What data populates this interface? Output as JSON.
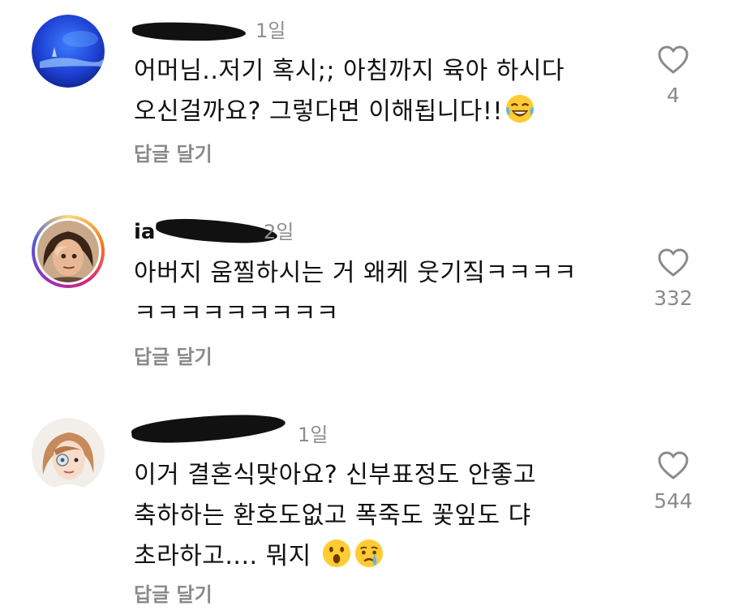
{
  "comments": [
    {
      "username_visible": "",
      "time": "1일",
      "text_line1": "어머님..저기 혹시;; 아침까지 육아 하시다",
      "text_line2": "오신걸까요? 그렇다면 이해됩니다!!",
      "emoji": [
        "laugh-tears-emoji"
      ],
      "reply_label": "답글 달기",
      "likes": "4"
    },
    {
      "username_visible": "ia",
      "time": "2일",
      "text_line1": "아버지 움찔하시는 거 왜케 웃기짘ㅋㅋㅋㅋ",
      "text_line2": "ㅋㅋㅋㅋㅋㅋㅋㅋㅋ",
      "emoji": [],
      "reply_label": "답글 달기",
      "likes": "332"
    },
    {
      "username_visible": "",
      "time": "1일",
      "text_line1": "이거 결혼식맞아요? 신부표정도 안좋고",
      "text_line2": "축하하는 환호도없고 폭죽도 꽃잎도 댜",
      "text_line3": "초라하고.... 뭐지",
      "emoji": [
        "surprised-emoji",
        "crying-emoji"
      ],
      "reply_label": "답글 달기",
      "likes": "544"
    }
  ],
  "icons": {
    "like": "heart-outline-icon"
  }
}
